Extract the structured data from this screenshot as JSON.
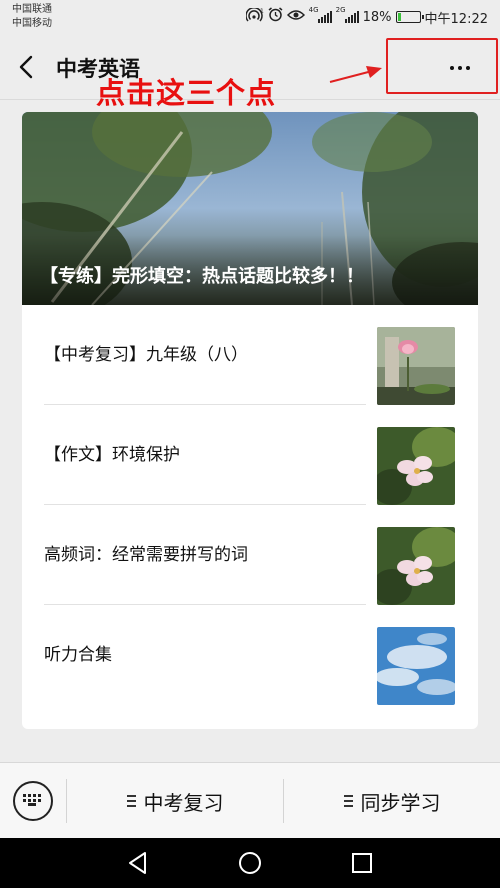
{
  "status_bar": {
    "carrier_1": "中国联通",
    "carrier_2": "中国移动",
    "network_1": "4G",
    "network_2": "2G",
    "battery": "18%",
    "battery_level": 0.18,
    "time": "中午12:22"
  },
  "header": {
    "title": "中考英语"
  },
  "annotation": {
    "text": "点击这三个点",
    "color": "#e81010"
  },
  "cover": {
    "title": "【专练】完形填空：热点话题比较多！！"
  },
  "articles": [
    {
      "title": "【中考复习】九年级（八）",
      "thumb": "lotus-flower-image"
    },
    {
      "title": "【作文】环境保护",
      "thumb": "pink-blossom-image"
    },
    {
      "title": "高频词：经常需要拼写的词",
      "thumb": "pink-blossom-image"
    },
    {
      "title": "听力合集",
      "thumb": "blue-sky-clouds-image"
    }
  ],
  "bottom_menu": {
    "item_1": "中考复习",
    "item_2": "同步学习"
  },
  "colors": {
    "background": "#ededed",
    "battery_green": "#3bbf3b",
    "annotation_red": "#e02020"
  }
}
